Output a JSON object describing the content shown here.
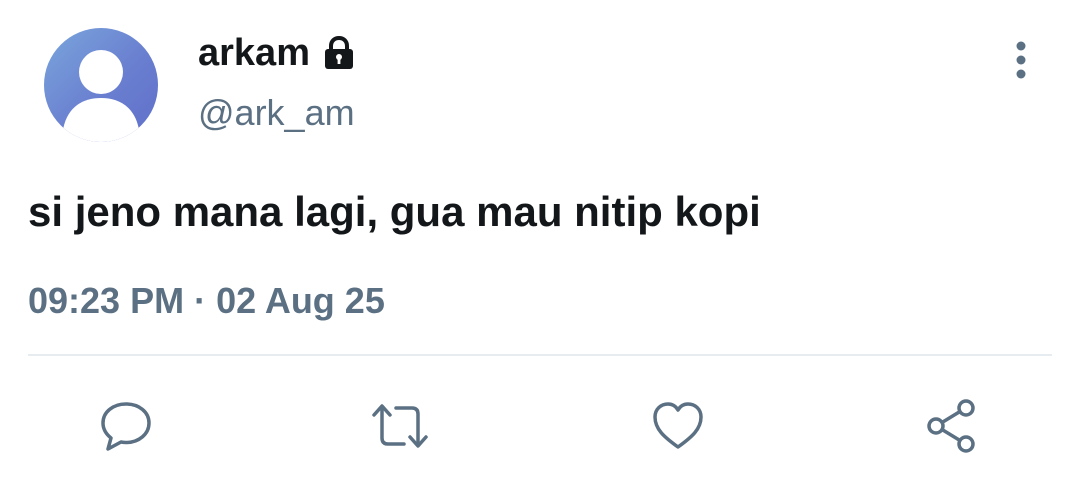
{
  "author": {
    "display_name": "arkam",
    "handle": "@ark_am",
    "avatar_icon": "default-user-avatar",
    "protected_icon": "lock-icon"
  },
  "tweet": {
    "text": "si jeno mana lagi, gua mau nitip kopi",
    "time": "09:23 PM",
    "separator": "·",
    "date": "02 Aug 25"
  },
  "actions": [
    {
      "name": "reply",
      "icon": "comment-icon"
    },
    {
      "name": "retweet",
      "icon": "retweet-icon"
    },
    {
      "name": "like",
      "icon": "heart-icon"
    },
    {
      "name": "share",
      "icon": "share-icon"
    }
  ],
  "menu_icon": "more-vertical-icon",
  "colors": {
    "text_primary": "#14171a",
    "text_secondary": "#5b7083",
    "icon": "#5b7083",
    "divider": "#e6ecf0",
    "avatar_gradient_start": "#7aa6dc",
    "avatar_gradient_end": "#5f6fc9"
  }
}
